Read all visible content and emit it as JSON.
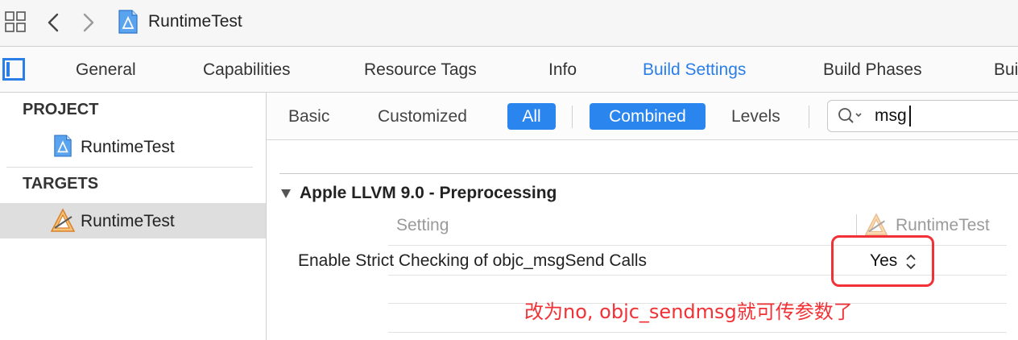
{
  "toolbar": {
    "breadcrumb_project": "RuntimeTest",
    "icons": [
      "grid-icon",
      "back-chevron-icon",
      "forward-chevron-icon",
      "xcode-project-icon"
    ]
  },
  "tabs": {
    "items": [
      "General",
      "Capabilities",
      "Resource Tags",
      "Info",
      "Build Settings",
      "Build Phases",
      "Bui"
    ],
    "active": "Build Settings"
  },
  "navigator": {
    "project_header": "PROJECT",
    "project_item": "RuntimeTest",
    "targets_header": "TARGETS",
    "target_item": "RuntimeTest"
  },
  "filter": {
    "basic": "Basic",
    "customized": "Customized",
    "all": "All",
    "combined": "Combined",
    "levels": "Levels",
    "search_value": "msg"
  },
  "content": {
    "section_title": "Apple LLVM 9.0 - Preprocessing",
    "column_setting": "Setting",
    "column_target": "RuntimeTest",
    "rows": [
      {
        "name": "Enable Strict Checking of objc_msgSend Calls",
        "value": "Yes"
      }
    ],
    "annotation": "改为no, objc_sendmsg就可传参数了"
  },
  "colors": {
    "accent": "#2a86ee",
    "annotation_red": "#f03236",
    "selection_gray": "#dedede"
  }
}
